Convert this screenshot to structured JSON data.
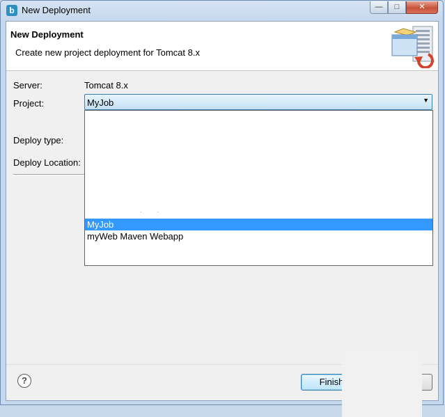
{
  "window": {
    "title": "New Deployment"
  },
  "header": {
    "title": "New Deployment",
    "subtitle": "Create new project deployment for Tomcat  8.x"
  },
  "form": {
    "server_label": "Server:",
    "server_value": "Tomcat  8.x",
    "project_label": "Project:",
    "project_value": "MyJob",
    "deploy_type_label": "Deploy type:",
    "deploy_location_label": "Deploy Location:"
  },
  "dropdown": {
    "options": [
      "MyJob",
      "myWeb Maven Webapp"
    ],
    "selected": "MyJob"
  },
  "buttons": {
    "finish": "Finish",
    "cancel": ""
  },
  "icons": [
    "app-icon",
    "server-deploy-icon",
    "help-icon",
    "chevron-down-icon",
    "minimize-icon",
    "maximize-icon",
    "close-icon"
  ]
}
